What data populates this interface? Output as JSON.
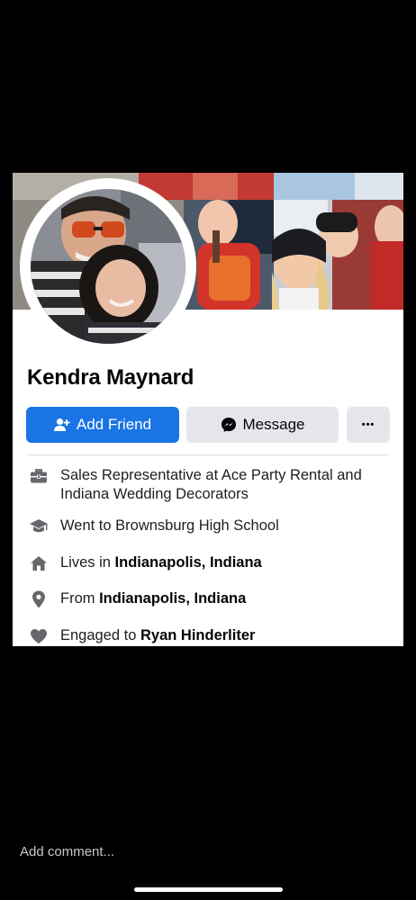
{
  "profile": {
    "name": "Kendra Maynard"
  },
  "actions": {
    "add_friend": "Add Friend",
    "message": "Message",
    "more": "•••"
  },
  "info": {
    "work": "Sales Representative at Ace Party Rental and Indiana Wedding Decorators",
    "education": "Went to Brownsburg High School",
    "lives_prefix": "Lives in ",
    "lives_place": "Indianapolis, Indiana",
    "from_prefix": "From ",
    "from_place": "Indianapolis, Indiana",
    "relationship_prefix": "Engaged to ",
    "relationship_person": "Ryan Hinderliter"
  },
  "comment": {
    "placeholder": "Add comment..."
  },
  "icons": {
    "work": "briefcase-icon",
    "education": "graduation-cap-icon",
    "lives": "home-icon",
    "from": "location-pin-icon",
    "relationship": "heart-icon",
    "add_friend": "add-person-icon",
    "message": "messenger-icon"
  },
  "colors": {
    "primary": "#1b74e4",
    "secondary_button": "#e4e6eb",
    "icon": "#65676b",
    "background": "#000000"
  }
}
